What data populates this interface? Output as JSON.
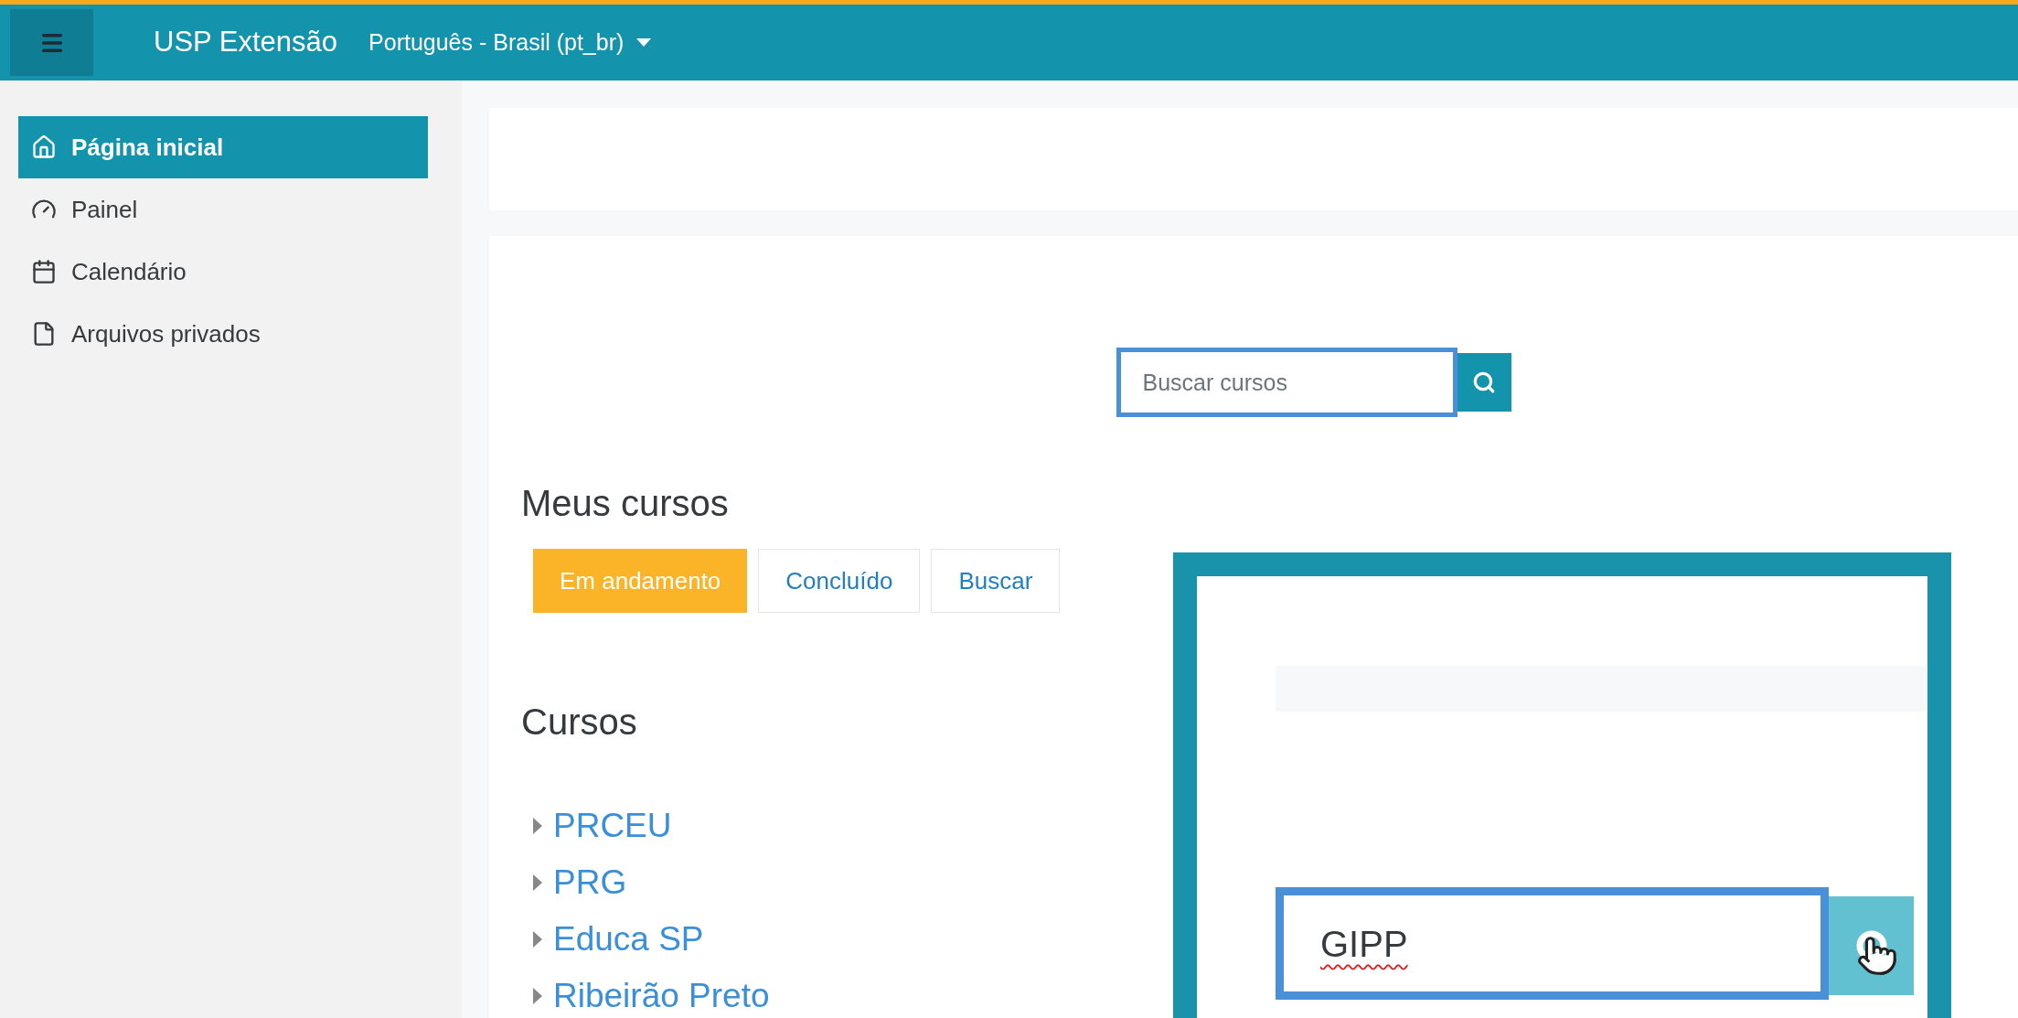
{
  "header": {
    "site_title": "USP Extensão",
    "language": "Português - Brasil (pt_br)"
  },
  "sidebar": {
    "items": [
      {
        "label": "Página inicial",
        "selected": true
      },
      {
        "label": "Painel",
        "selected": false
      },
      {
        "label": "Calendário",
        "selected": false
      },
      {
        "label": "Arquivos privados",
        "selected": false
      }
    ]
  },
  "search": {
    "placeholder": "Buscar cursos",
    "focused": true
  },
  "my_courses": {
    "title": "Meus cursos",
    "tabs": [
      {
        "label": "Em andamento",
        "selected": true
      },
      {
        "label": "Concluído",
        "selected": false
      },
      {
        "label": "Buscar",
        "selected": false
      }
    ]
  },
  "courses": {
    "title": "Cursos",
    "items": [
      {
        "label": "PRCEU",
        "expanded": false
      },
      {
        "label": "PRG",
        "expanded": false
      },
      {
        "label": "Educa SP",
        "expanded": false
      },
      {
        "label": "Ribeirão Preto",
        "expanded": false
      }
    ]
  },
  "zoom_inset": {
    "search_value": "GIPP",
    "focused": true
  }
}
